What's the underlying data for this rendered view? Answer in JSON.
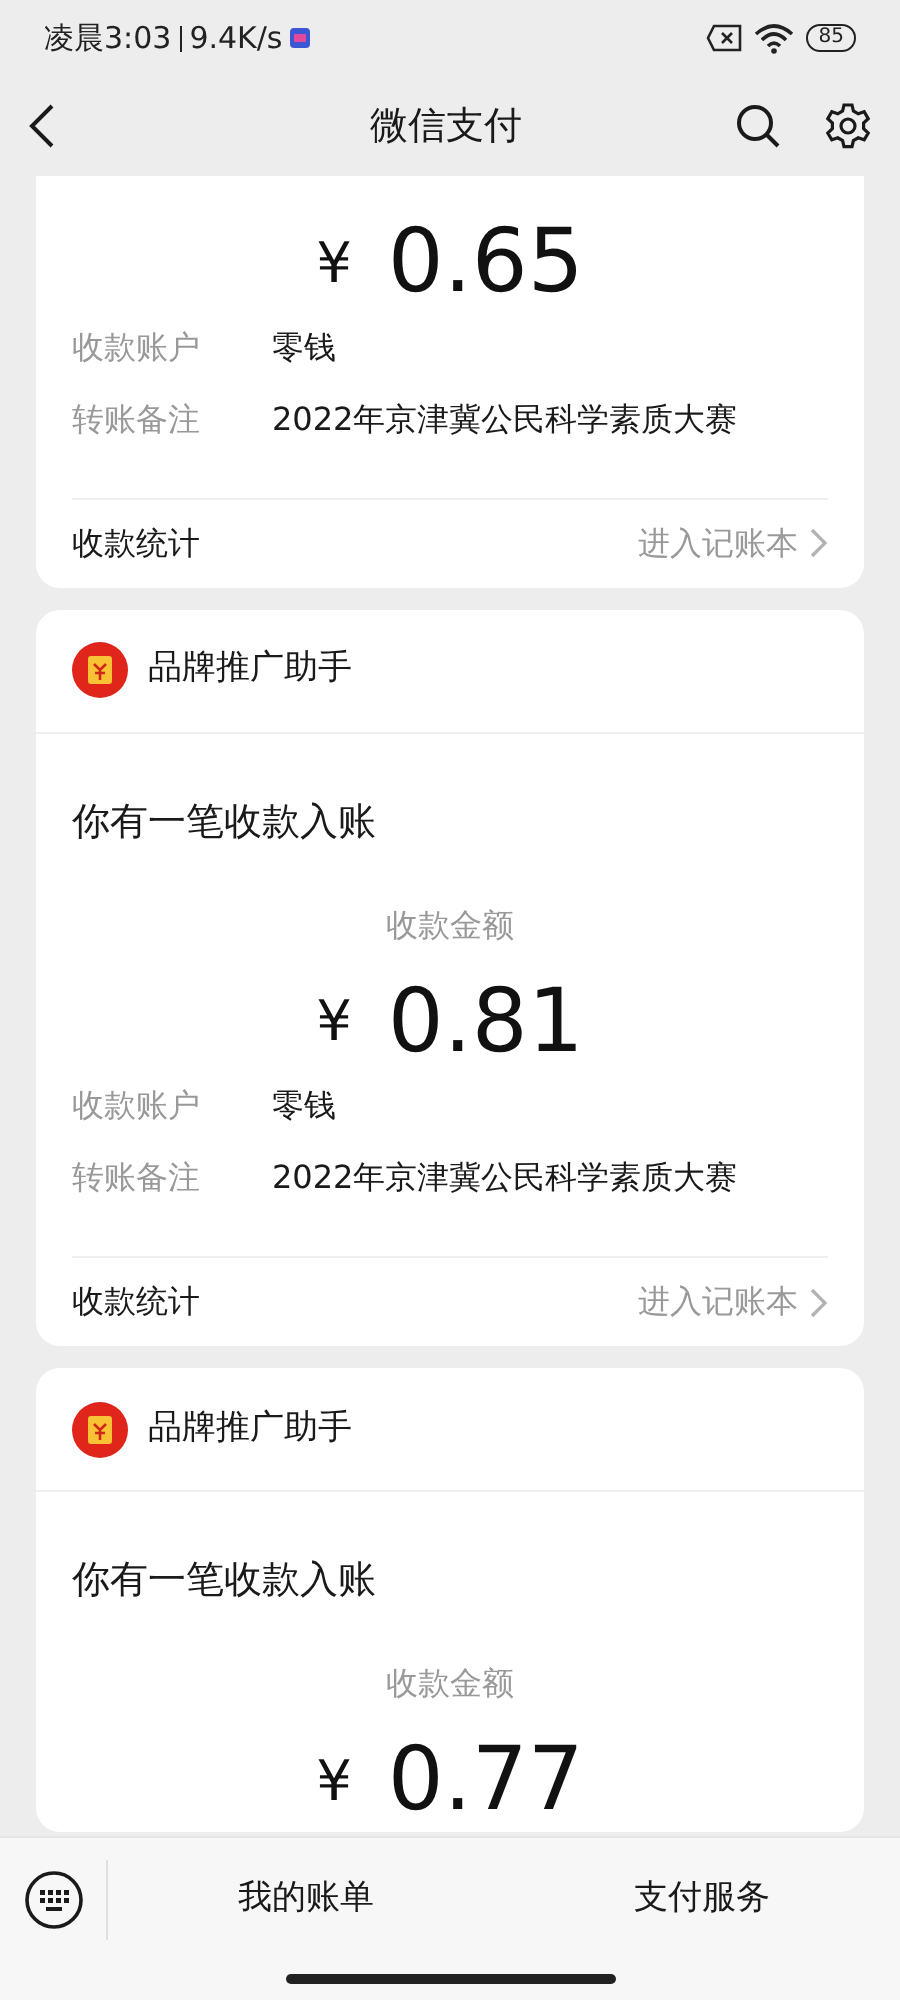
{
  "status_bar": {
    "time": "凌晨3:03",
    "speed": "9.4K/s",
    "battery": "85"
  },
  "header": {
    "title": "微信支付"
  },
  "messages": [
    {
      "currency": "¥",
      "amount": "0.65",
      "rows": [
        {
          "label": "收款账户",
          "value": "零钱"
        },
        {
          "label": "转账备注",
          "value": "2022年京津冀公民科学素质大赛"
        }
      ],
      "footer": {
        "label": "收款统计",
        "link": "进入记账本"
      }
    },
    {
      "sender": "品牌推广助手",
      "intro": "你有一笔收款入账",
      "amount_label": "收款金额",
      "currency": "¥",
      "amount": "0.81",
      "rows": [
        {
          "label": "收款账户",
          "value": "零钱"
        },
        {
          "label": "转账备注",
          "value": "2022年京津冀公民科学素质大赛"
        }
      ],
      "footer": {
        "label": "收款统计",
        "link": "进入记账本"
      }
    },
    {
      "sender": "品牌推广助手",
      "intro": "你有一笔收款入账",
      "amount_label": "收款金额",
      "currency": "¥",
      "amount": "0.77"
    }
  ],
  "bottom_menu": [
    {
      "label": "我的账单"
    },
    {
      "label": "支付服务"
    }
  ]
}
